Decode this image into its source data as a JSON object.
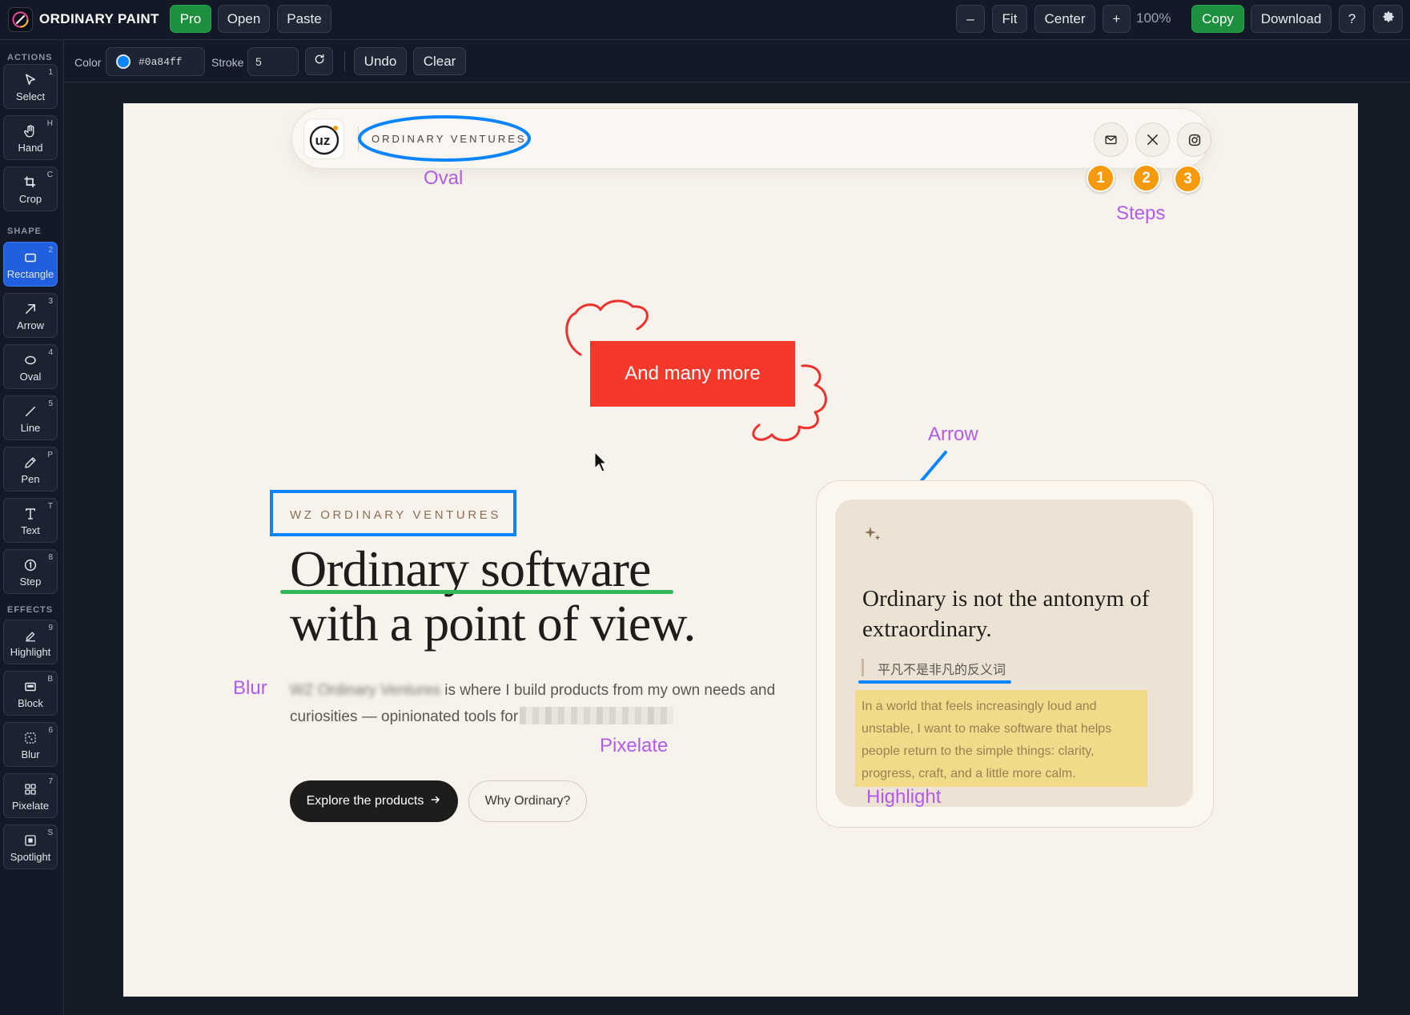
{
  "app": {
    "name": "ORDINARY PAINT",
    "pro_label": "Pro",
    "open_label": "Open",
    "paste_label": "Paste"
  },
  "view": {
    "zoom_out_label": "–",
    "fit_label": "Fit",
    "center_label": "Center",
    "zoom_in_label": "+",
    "zoom_value": "100%",
    "copy_label": "Copy",
    "download_label": "Download",
    "help_label": "?",
    "settings_icon": "gear-icon"
  },
  "rail": {
    "sections": {
      "actions": "ACTIONS",
      "shape": "SHAPE",
      "effects": "EFFECTS"
    },
    "tools": [
      {
        "label": "Select",
        "key": "1",
        "icon": "cursor-icon"
      },
      {
        "label": "Hand",
        "key": "H",
        "icon": "hand-icon"
      },
      {
        "label": "Crop",
        "key": "C",
        "icon": "crop-icon"
      },
      {
        "label": "Rectangle",
        "key": "2",
        "icon": "rectangle-icon",
        "active": true
      },
      {
        "label": "Arrow",
        "key": "3",
        "icon": "arrow-icon"
      },
      {
        "label": "Oval",
        "key": "4",
        "icon": "oval-icon"
      },
      {
        "label": "Line",
        "key": "5",
        "icon": "line-icon"
      },
      {
        "label": "Pen",
        "key": "P",
        "icon": "pen-icon"
      },
      {
        "label": "Text",
        "key": "T",
        "icon": "text-icon"
      },
      {
        "label": "Step",
        "key": "8",
        "icon": "step-icon"
      },
      {
        "label": "Highlight",
        "key": "9",
        "icon": "highlighter-icon"
      },
      {
        "label": "Block",
        "key": "B",
        "icon": "block-icon"
      },
      {
        "label": "Blur",
        "key": "6",
        "icon": "blur-icon"
      },
      {
        "label": "Pixelate",
        "key": "7",
        "icon": "pixelate-icon"
      },
      {
        "label": "Spotlight",
        "key": "S",
        "icon": "spotlight-icon"
      }
    ]
  },
  "toolbar": {
    "color_label": "Color",
    "color_value": "#0a84ff",
    "stroke_label": "Stroke",
    "stroke_value": "5",
    "undo_label": "Undo",
    "clear_label": "Clear"
  },
  "canvas": {
    "site_name": "ORDINARY VENTURES",
    "social_icons": [
      "mail-icon",
      "x-icon",
      "instagram-icon"
    ],
    "annotations": {
      "oval": "Oval",
      "steps": "Steps",
      "arrow": "Arrow",
      "blur": "Blur",
      "pixelate": "Pixelate",
      "highlight": "Highlight"
    },
    "steps": [
      "1",
      "2",
      "3"
    ],
    "block_text": "And many more",
    "eyebrow": "WZ ORDINARY VENTURES",
    "headline_line1": "Ordinary software",
    "headline_line2": "with a point of view.",
    "lead_blurred": "WZ Ordinary Ventures",
    "lead_text": " is where I build products from my own needs and curiosities — opinionated tools for",
    "cta_primary": "Explore the products",
    "cta_primary_icon": "arrow-right-icon",
    "cta_secondary": "Why Ordinary?",
    "quote": "Ordinary is not the antonym of extraordinary.",
    "quote_zh": "平凡不是非凡的反义词",
    "quote_body": "In a world that feels increasingly loud and unstable, I want to make software that helps people return to the simple things: clarity, progress, craft, and a little more calm.",
    "sparkle_icon": "sparkle-icon"
  },
  "colors": {
    "accent_blue": "#0a84ff",
    "active_tool": "#1f5fe0",
    "green_button": "#1e8f3e",
    "annotation_purple": "#b15ce6",
    "step_orange": "#f59a0c",
    "block_red": "#f5382a",
    "pen_red": "#f0302a",
    "highlight_yellow": "#f1da8a",
    "underline_green": "#34b85a"
  }
}
